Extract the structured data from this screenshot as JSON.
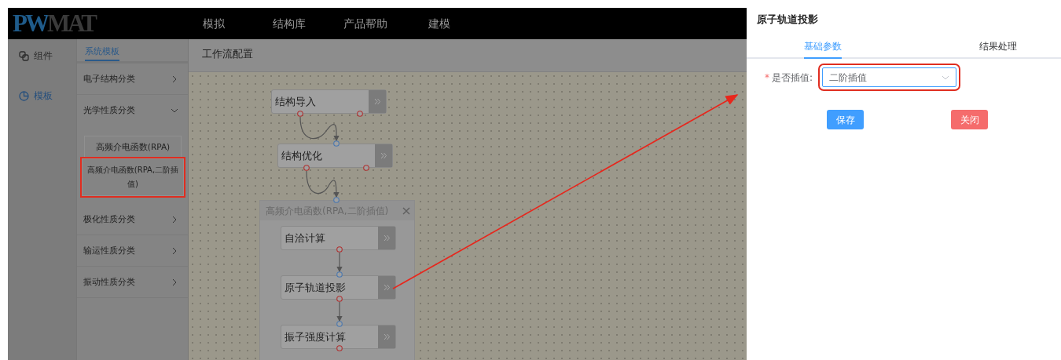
{
  "header": {
    "logo_parts": [
      "PW",
      "MAT"
    ],
    "nav": [
      {
        "label": "模拟"
      },
      {
        "label": "结构库"
      },
      {
        "label": "产品帮助"
      },
      {
        "label": "建模"
      }
    ]
  },
  "icon_sidebar": {
    "items": [
      {
        "label": "组件",
        "kind": "components",
        "selected": false
      },
      {
        "label": "模板",
        "kind": "templates",
        "selected": true
      }
    ]
  },
  "template_panel": {
    "tabs": [
      {
        "label": "系统模板",
        "selected": true
      }
    ],
    "categories": [
      {
        "label": "电子结构分类",
        "expanded": false
      },
      {
        "label": "光学性质分类",
        "expanded": true,
        "children": [
          {
            "label": "高频介电函数(RPA)",
            "highlighted": false
          },
          {
            "label": "高频介电函数(RPA,二阶插值)",
            "highlighted": true
          }
        ]
      },
      {
        "label": "极化性质分类",
        "expanded": false
      },
      {
        "label": "输运性质分类",
        "expanded": false
      },
      {
        "label": "振动性质分类",
        "expanded": false
      }
    ]
  },
  "workflow": {
    "title": "工作流配置",
    "nodes": [
      {
        "label": "结构导入"
      },
      {
        "label": "结构优化"
      }
    ],
    "group": {
      "title": "高频介电函数(RPA,二阶插值)",
      "nodes": [
        {
          "label": "自洽计算"
        },
        {
          "label": "原子轨道投影"
        },
        {
          "label": "振子强度计算"
        }
      ]
    }
  },
  "drawer": {
    "title": "原子轨道投影",
    "tabs": [
      {
        "label": "基础参数",
        "selected": true
      },
      {
        "label": "结果处理",
        "selected": false
      }
    ],
    "fields": [
      {
        "required_mark": "*",
        "label": "是否插值:",
        "value": "二阶插值",
        "highlighted": true
      }
    ],
    "buttons": [
      {
        "label": "保存",
        "kind": "primary"
      },
      {
        "label": "关闭",
        "kind": "danger"
      }
    ]
  }
}
